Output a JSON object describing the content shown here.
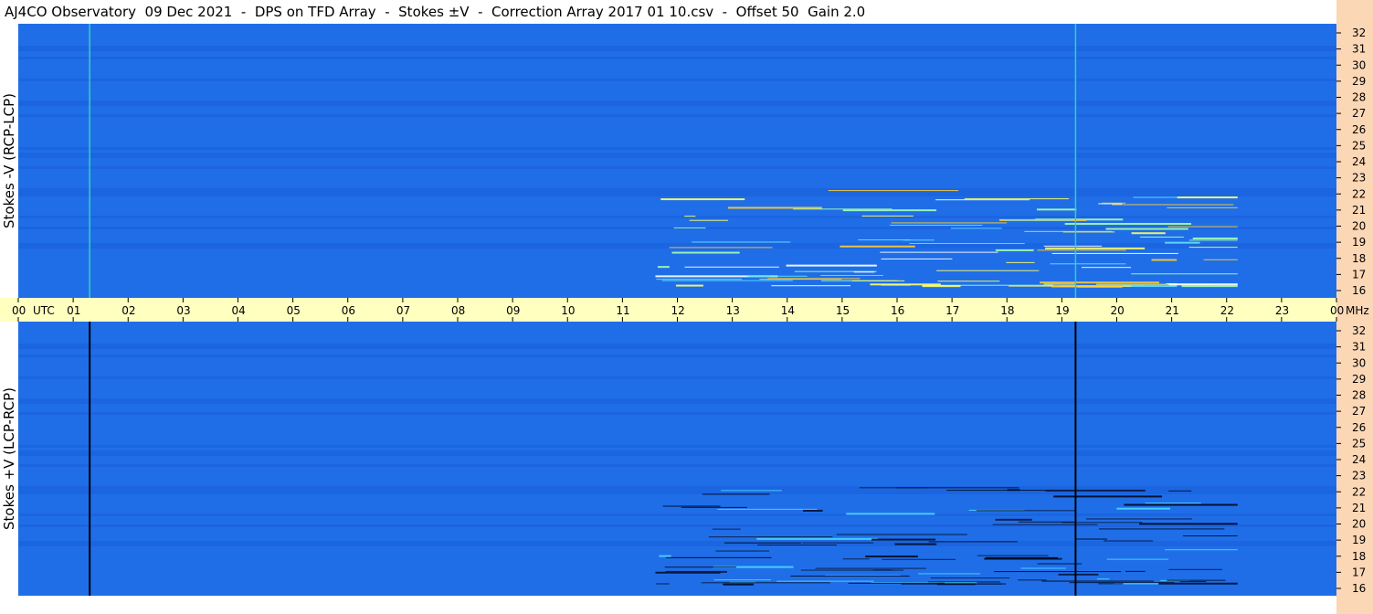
{
  "title": "AJ4CO Observatory  09 Dec 2021  -  DPS on TFD Array  -  Stokes ±V  -  Correction Array 2017 01 10.csv  -  Offset 50  Gain 2.0",
  "panels": {
    "top_label": "Stokes -V (RCP-LCP)",
    "bottom_label": "Stokes +V (LCP-RCP)"
  },
  "colors": {
    "background_blue": "#1f6ee8",
    "band_blue_dark": "#1a5fd8",
    "time_axis_bg": "#ffffc0",
    "freq_strip_bg": "#fbd7b6",
    "marker_top": "#2fd0c0",
    "marker_bottom": "#000000"
  },
  "chart_data": {
    "type": "heatmap",
    "x_axis": {
      "unit_label": "UTC",
      "ticks": [
        "00",
        "01",
        "02",
        "03",
        "04",
        "05",
        "06",
        "07",
        "08",
        "09",
        "10",
        "11",
        "12",
        "13",
        "14",
        "15",
        "16",
        "17",
        "18",
        "19",
        "20",
        "21",
        "22",
        "23",
        "00"
      ],
      "range_hours": [
        0,
        24
      ]
    },
    "y_axis": {
      "unit_label": "MHz",
      "ticks": [
        "16",
        "17",
        "18",
        "19",
        "20",
        "21",
        "22",
        "23",
        "24",
        "25",
        "26",
        "27",
        "28",
        "29",
        "30",
        "31",
        "32"
      ],
      "range_mhz": [
        16,
        32
      ]
    },
    "markers_utc_hours": [
      1.3,
      19.25
    ],
    "features": [
      {
        "description": "Jupiter-like burst emission / interference lines",
        "utc_start": 11.6,
        "utc_end": 22.2,
        "mhz_start": 16,
        "mhz_end": 22
      }
    ]
  }
}
